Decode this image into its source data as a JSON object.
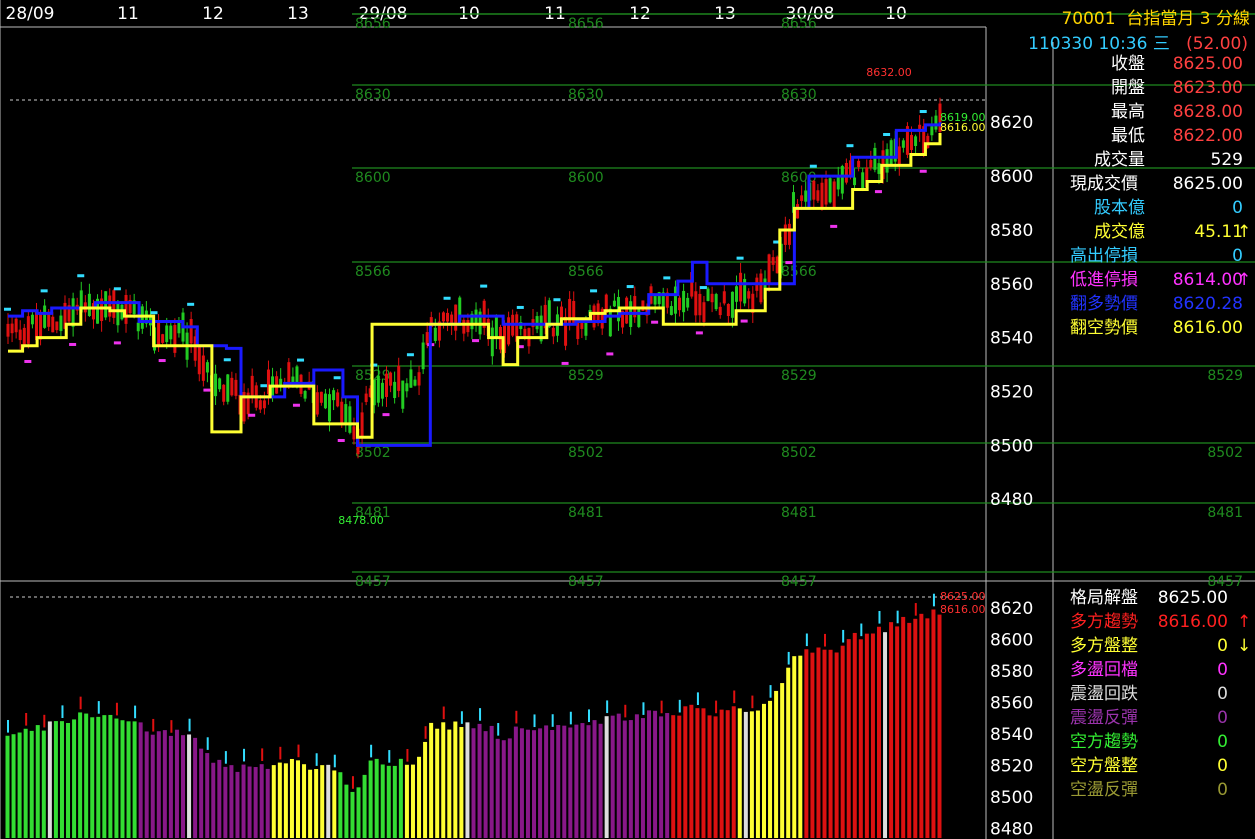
{
  "header": {
    "code": "70001",
    "title": "台指當月 3 分線",
    "date": "110330 10:36 三",
    "change": "(52.00)"
  },
  "stats": [
    {
      "label": "收盤",
      "value": "8625.00",
      "lc": "#ffffff",
      "vc": "#ff4040",
      "arrow": ""
    },
    {
      "label": "開盤",
      "value": "8623.00",
      "lc": "#ffffff",
      "vc": "#ff4040",
      "arrow": ""
    },
    {
      "label": "最高",
      "value": "8628.00",
      "lc": "#ffffff",
      "vc": "#ff4040",
      "arrow": ""
    },
    {
      "label": "最低",
      "value": "8622.00",
      "lc": "#ffffff",
      "vc": "#ff4040",
      "arrow": ""
    },
    {
      "label": "成交量",
      "value": "529",
      "lc": "#ffffff",
      "vc": "#ffffff",
      "arrow": ""
    },
    {
      "label": "現成交價",
      "value": "8625.00",
      "lc": "#ffffff",
      "vc": "#ffffff",
      "arrow": ""
    },
    {
      "label": "股本億",
      "value": "0",
      "lc": "#33ccff",
      "vc": "#33ccff",
      "arrow": ""
    },
    {
      "label": "成交億",
      "value": "45.11",
      "lc": "#ffff33",
      "vc": "#ffff33",
      "arrow": "↑",
      "ac": "#ffff33"
    },
    {
      "label": "高出停損",
      "value": "0",
      "lc": "#33ccff",
      "vc": "#33ccff",
      "arrow": ""
    },
    {
      "label": "低進停損",
      "value": "8614.00",
      "lc": "#ff33ff",
      "vc": "#ff33ff",
      "arrow": "↑",
      "ac": "#ff33ff"
    },
    {
      "label": "翻多勢價",
      "value": "8620.28",
      "lc": "#2233ff",
      "vc": "#2233ff",
      "arrow": ""
    },
    {
      "label": "翻空勢價",
      "value": "8616.00",
      "lc": "#ffff33",
      "vc": "#ffff33",
      "arrow": ""
    }
  ],
  "stats2": [
    {
      "label": "格局解盤",
      "value": "8625.00",
      "lc": "#ffffff",
      "vc": "#ffffff",
      "arrow": ""
    },
    {
      "label": "多方趨勢",
      "value": "8616.00",
      "lc": "#ff2020",
      "vc": "#ff2020",
      "arrow": "↑",
      "ac": "#ff2020"
    },
    {
      "label": "多方盤整",
      "value": "0",
      "lc": "#ffff33",
      "vc": "#ffff33",
      "arrow": "↓",
      "ac": "#ffff33"
    },
    {
      "label": "多盪回檔",
      "value": "0",
      "lc": "#ff33ff",
      "vc": "#ff33ff",
      "arrow": ""
    },
    {
      "label": "震盪回跌",
      "value": "0",
      "lc": "#dddddd",
      "vc": "#dddddd",
      "arrow": ""
    },
    {
      "label": "震盪反彈",
      "value": "0",
      "lc": "#9933aa",
      "vc": "#9933aa",
      "arrow": ""
    },
    {
      "label": "空方趨勢",
      "value": "0",
      "lc": "#33ee33",
      "vc": "#33ee33",
      "arrow": ""
    },
    {
      "label": "空方盤整",
      "value": "0",
      "lc": "#ffff33",
      "vc": "#ffff33",
      "arrow": ""
    },
    {
      "label": "空盪反彈",
      "value": "0",
      "lc": "#999933",
      "vc": "#999933",
      "arrow": ""
    }
  ],
  "chart_data": [
    {
      "type": "line",
      "panel": "main",
      "x_ticks": [
        "28/09",
        "11",
        "12",
        "13",
        "29/08",
        "10",
        "11",
        "12",
        "13",
        "30/08",
        "10"
      ],
      "y_ticks": [
        8620,
        8600,
        8580,
        8560,
        8540,
        8520,
        8500,
        8480
      ],
      "ylim": [
        8450,
        8655
      ],
      "level_lines": [
        8656,
        8630,
        8600,
        8566,
        8529,
        8502,
        8481,
        8457
      ],
      "annotations": [
        "8632.00",
        "8619.00",
        "8616.00",
        "8478.00"
      ],
      "series": [
        {
          "color": "#1a1aff",
          "values": [
            8548,
            8550,
            8549,
            8551,
            8551,
            8551,
            8553,
            8553,
            8553,
            8546,
            8546,
            8546,
            8544,
            8537,
            8537,
            8536,
            8518,
            8518,
            8518,
            8523,
            8523,
            8528,
            8528,
            8518,
            8500,
            8500,
            8500,
            8500,
            8500,
            8545,
            8545,
            8548,
            8548,
            8548,
            8545,
            8545,
            8545,
            8545,
            8545,
            8546,
            8546,
            8548,
            8549,
            8549,
            8556,
            8556,
            8561,
            8568,
            8560,
            8560,
            8560,
            8560,
            8560,
            8560,
            8588,
            8600,
            8600,
            8600,
            8607,
            8607,
            8607,
            8617,
            8617,
            8619,
            8620
          ]
        },
        {
          "color": "#ffff33",
          "values": [
            8535,
            8537,
            8540,
            8540,
            8545,
            8551,
            8551,
            8550,
            8548,
            8548,
            8537,
            8537,
            8537,
            8537,
            8505,
            8505,
            8518,
            8518,
            8522,
            8522,
            8522,
            8508,
            8508,
            8508,
            8503,
            8545,
            8545,
            8545,
            8545,
            8545,
            8545,
            8545,
            8545,
            8540,
            8530,
            8540,
            8540,
            8545,
            8547,
            8547,
            8549,
            8550,
            8551,
            8551,
            8551,
            8545,
            8545,
            8545,
            8545,
            8545,
            8550,
            8550,
            8558,
            8580,
            8588,
            8588,
            8588,
            8588,
            8595,
            8598,
            8604,
            8604,
            8608,
            8612,
            8616
          ]
        }
      ]
    },
    {
      "type": "bar",
      "panel": "sub",
      "y_ticks": [
        8620,
        8600,
        8580,
        8560,
        8540,
        8520,
        8500,
        8480
      ],
      "ylim": [
        8474,
        8630
      ],
      "annotations": [
        "8625.00",
        "8616.00"
      ]
    }
  ]
}
